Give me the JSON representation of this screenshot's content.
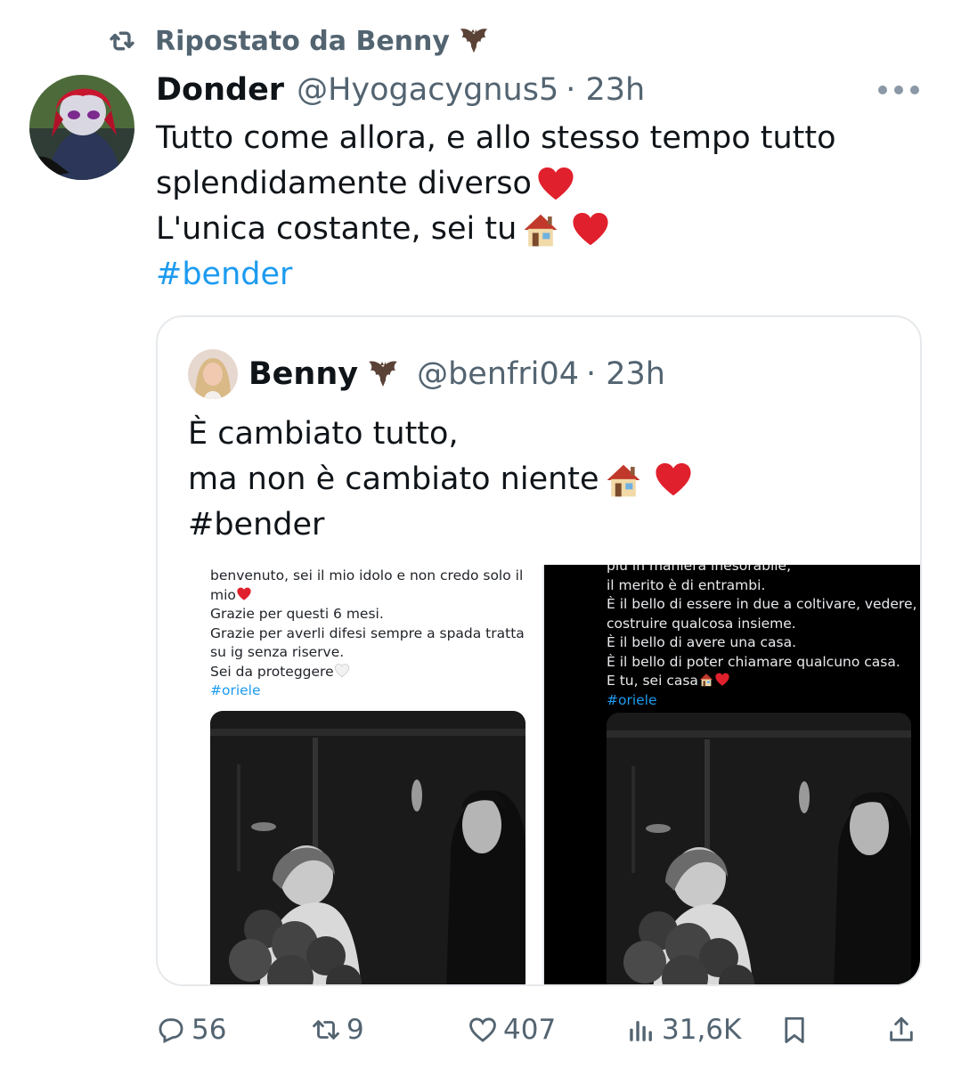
{
  "repost": {
    "label": "Ripostato da Benny",
    "icon": "repost-icon"
  },
  "tweet": {
    "author_name": "Donder",
    "author_handle": "@Hyogacygnus5",
    "time": "· 23h",
    "lines": [
      "Tutto come allora, e allo stesso tempo tutto",
      "splendidamente diverso",
      "L'unica costante, sei tu",
      "#bender"
    ]
  },
  "quote": {
    "author_name": "Benny",
    "author_handle": "@benfri04",
    "time": "· 23h",
    "lines": [
      "È cambiato tutto,",
      "ma non è cambiato niente",
      "#bender"
    ],
    "media_left": {
      "lines": [
        "benvenuto, sei il mio idolo e non credo solo il",
        "mio",
        "Grazie per questi 6 mesi.",
        "Grazie per averli difesi sempre a spada tratta",
        "su ig senza riserve.",
        "Sei da proteggere",
        "#oriele"
      ]
    },
    "media_right": {
      "lines": [
        "più in maniera inesorabile,",
        "il merito è di entrambi.",
        "È il bello di essere in due a coltivare, vedere,",
        "costruire qualcosa insieme.",
        "È il bello di avere una casa.",
        "È il bello di poter chiamare qualcuno casa.",
        "E tu, sei casa",
        "#oriele"
      ]
    }
  },
  "actions": {
    "replies": "56",
    "reposts": "9",
    "likes": "407",
    "views": "31,6K"
  },
  "colors": {
    "accent": "#1d9bf0",
    "muted": "#536471",
    "text": "#0f1419"
  }
}
